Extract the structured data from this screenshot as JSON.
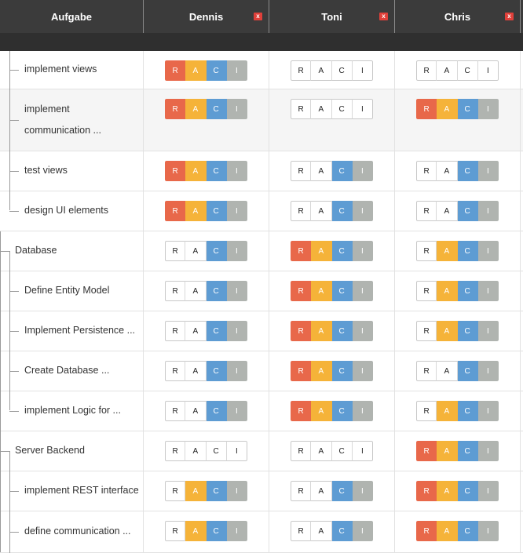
{
  "header": {
    "task_col": "Aufgabe",
    "people": [
      "Dennis",
      "Toni",
      "Chris"
    ],
    "remove_label": "x"
  },
  "letters": [
    "R",
    "A",
    "C",
    "I"
  ],
  "colors": {
    "R": "#e8684a",
    "A": "#f5b339",
    "C": "#5e9cd3",
    "I": "#b0b4b0"
  },
  "rows": [
    {
      "label": "implement views",
      "level": 2,
      "shaded": false,
      "lines": 1,
      "raci": [
        [
          "R",
          "A",
          "C",
          "I"
        ],
        [],
        []
      ]
    },
    {
      "label": "implement",
      "label2": "communication ...",
      "level": 2,
      "shaded": true,
      "lines": 2,
      "raci": [
        [
          "R",
          "A",
          "C",
          "I"
        ],
        [],
        [
          "R",
          "A",
          "C",
          "I"
        ]
      ]
    },
    {
      "label": "test views",
      "level": 2,
      "shaded": false,
      "lines": 1,
      "raci": [
        [
          "R",
          "A",
          "C",
          "I"
        ],
        [
          "C",
          "I"
        ],
        [
          "C",
          "I"
        ]
      ]
    },
    {
      "label": "design UI elements",
      "level": 2,
      "shaded": false,
      "lines": 1,
      "raci": [
        [
          "R",
          "A",
          "C",
          "I"
        ],
        [
          "C",
          "I"
        ],
        [
          "C",
          "I"
        ]
      ]
    },
    {
      "label": "Database",
      "level": 1,
      "shaded": false,
      "lines": 1,
      "raci": [
        [
          "C",
          "I"
        ],
        [
          "R",
          "A",
          "C",
          "I"
        ],
        [
          "A",
          "C",
          "I"
        ]
      ]
    },
    {
      "label": "Define Entity Model",
      "level": 2,
      "shaded": false,
      "lines": 1,
      "raci": [
        [
          "C",
          "I"
        ],
        [
          "R",
          "A",
          "C",
          "I"
        ],
        [
          "A",
          "C",
          "I"
        ]
      ]
    },
    {
      "label": "Implement Persistence ...",
      "level": 2,
      "shaded": false,
      "lines": 1,
      "raci": [
        [
          "C",
          "I"
        ],
        [
          "R",
          "A",
          "C",
          "I"
        ],
        [
          "A",
          "C",
          "I"
        ]
      ]
    },
    {
      "label": "Create Database ...",
      "level": 2,
      "shaded": false,
      "lines": 1,
      "raci": [
        [
          "C",
          "I"
        ],
        [
          "R",
          "A",
          "C",
          "I"
        ],
        [
          "C",
          "I"
        ]
      ]
    },
    {
      "label": "implement Logic for ...",
      "level": 2,
      "shaded": false,
      "lines": 1,
      "raci": [
        [
          "C",
          "I"
        ],
        [
          "R",
          "A",
          "C",
          "I"
        ],
        [
          "A",
          "C",
          "I"
        ]
      ]
    },
    {
      "label": "Server Backend",
      "level": 1,
      "shaded": false,
      "lines": 1,
      "raci": [
        [],
        [],
        [
          "R",
          "A",
          "C",
          "I"
        ]
      ]
    },
    {
      "label": "implement REST interface",
      "level": 2,
      "shaded": false,
      "lines": 1,
      "raci": [
        [
          "A",
          "C",
          "I"
        ],
        [
          "C",
          "I"
        ],
        [
          "R",
          "A",
          "C",
          "I"
        ]
      ]
    },
    {
      "label": "define communication ...",
      "level": 2,
      "shaded": false,
      "lines": 1,
      "raci": [
        [
          "A",
          "C",
          "I"
        ],
        [
          "C",
          "I"
        ],
        [
          "R",
          "A",
          "C",
          "I"
        ]
      ]
    }
  ]
}
